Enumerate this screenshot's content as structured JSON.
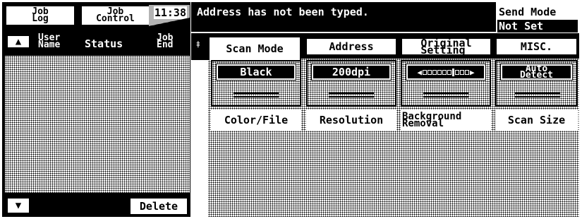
{
  "header": {
    "job_log": [
      "Job",
      "Log"
    ],
    "job_control": [
      "Job",
      "Control"
    ],
    "clock": "11:38",
    "message": "Address has not been typed.",
    "send_mode_label": "Send Mode",
    "send_mode_value": "Not Set"
  },
  "job_list": {
    "columns": {
      "user_name": [
        "User",
        "Name"
      ],
      "status": "Status",
      "job_end": [
        "Job",
        "End"
      ]
    },
    "sort_up_icon": "▲",
    "sort_down_icon": "▼",
    "delete_label": "Delete"
  },
  "tabs": [
    {
      "label": "Scan Mode",
      "active": true
    },
    {
      "label": "Address",
      "active": false
    },
    {
      "label_lines": [
        "Original",
        "Setting"
      ],
      "active": false
    },
    {
      "label": "MISC.",
      "active": false
    }
  ],
  "settings": [
    {
      "value": "Black",
      "label": "Color/File"
    },
    {
      "value": "200dpi",
      "label": "Resolution"
    },
    {
      "value_icon": "density-slider-icon",
      "label_lines": [
        "Background",
        "Removal"
      ]
    },
    {
      "value_lines": [
        "Auto",
        "Detect"
      ],
      "label": "Scan Size"
    }
  ]
}
